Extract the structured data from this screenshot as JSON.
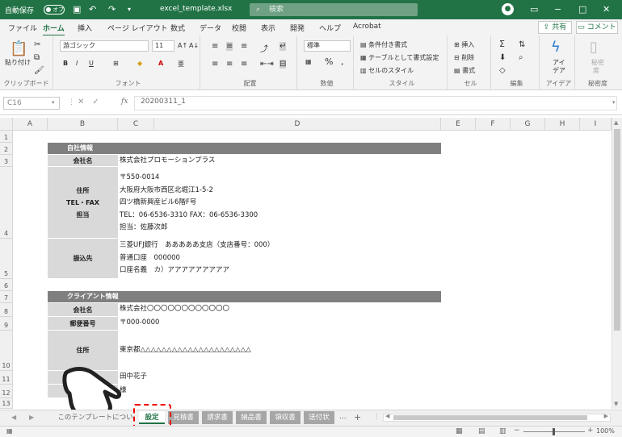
{
  "titlebar": {
    "autosave": "自動保存",
    "toggle": "オフ",
    "filename": "excel_template.xlsx",
    "search_placeholder": "検索"
  },
  "menu": {
    "items": [
      "ファイル",
      "ホーム",
      "挿入",
      "ページ レイアウト",
      "数式",
      "データ",
      "校閲",
      "表示",
      "開発",
      "ヘルプ",
      "Acrobat"
    ],
    "active_index": 1,
    "share": "共有",
    "comment": "コメント"
  },
  "ribbon": {
    "clipboard": {
      "paste": "貼り付け",
      "label": "クリップボード"
    },
    "font": {
      "name": "游ゴシック",
      "size": "11",
      "label": "フォント",
      "bold": "B",
      "italic": "I",
      "underline": "U"
    },
    "alignment": {
      "label": "配置"
    },
    "number": {
      "format": "標準",
      "percent": "%",
      "comma": ",",
      "label": "数値"
    },
    "styles": {
      "conditional": "条件付き書式",
      "table": "テーブルとして書式設定",
      "cell": "セルのスタイル",
      "label": "スタイル"
    },
    "cells": {
      "insert": "挿入",
      "delete": "削除",
      "format": "書式",
      "label": "セル"
    },
    "editing": {
      "label": "編集"
    },
    "ideas": {
      "label1": "アイ",
      "label2": "デア",
      "group": "アイデア"
    },
    "sensitivity": {
      "label1": "秘密",
      "label2": "度",
      "group": "秘密度"
    }
  },
  "formula": {
    "cell_ref": "C16",
    "fx": "fx",
    "value": "20200311_1"
  },
  "columns": [
    "A",
    "B",
    "C",
    "D",
    "E",
    "F",
    "G",
    "H",
    "I"
  ],
  "rows": [
    "1",
    "2",
    "3",
    "4",
    "5",
    "6",
    "7",
    "8",
    "9",
    "10",
    "11",
    "12",
    "13"
  ],
  "sheet": {
    "company_section": "自社情報",
    "company_label": "会社名",
    "company_value": "株式会社プロモーションプラス",
    "address_labels": [
      "住所",
      "TEL・FAX",
      "担当"
    ],
    "address_lines": [
      "〒550-0014",
      "大阪府大阪市西区北堀江1-5-2",
      "四ツ橋新興産ビル6階F号",
      "TEL：06-6536-3310  FAX：06-6536-3300",
      "担当：佐藤次郎"
    ],
    "bank_label": "振込先",
    "bank_lines": [
      "三菱UFJ銀行　あああああ支店（支店番号：000）",
      "普通口座　000000",
      "口座名義　カ）アアアアアアアアア"
    ],
    "client_section": "クライアント情報",
    "client_label": "会社名",
    "client_value": "株式会社〇〇〇〇〇〇〇〇〇〇〇〇",
    "zip_label": "郵便番号",
    "zip_value": "〒000-0000",
    "addr_label": "住所",
    "addr_value": "東京都△△△△△△△△△△△△△△△△△△△△△",
    "name_value": "田中花子",
    "honorific": "様"
  },
  "tabs": {
    "nav_left": "◀",
    "nav_right": "▶",
    "items": [
      "このテンプレートについて",
      "設定",
      "見積書",
      "請求書",
      "納品書",
      "領収書",
      "送付状"
    ],
    "active_index": 1,
    "more": "...",
    "add": "+"
  },
  "status": {
    "zoom": "100%"
  }
}
